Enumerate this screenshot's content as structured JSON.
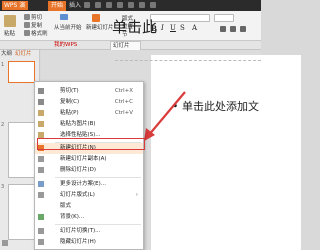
{
  "titlebar": {
    "app_label": "WPS 演示",
    "tab_start": "开始",
    "tab_insert": "插入"
  },
  "ribbon": {
    "paste": "粘贴",
    "cut": "剪切",
    "copy": "复制",
    "format_painter": "格式刷",
    "from_current": "从当前开始",
    "new_slide": "新建幻灯片",
    "layout": "版式",
    "reset": "重置",
    "section": "节"
  },
  "doctabs": {
    "wps": "我的WPS",
    "active": "幻灯片"
  },
  "left_panel": {
    "outline": "大纲",
    "slides": "幻灯片",
    "slide_numbers": [
      "1",
      "2",
      "3"
    ]
  },
  "slide": {
    "title": "单击此",
    "bullet": "• 单击此处添加文"
  },
  "context_menu": {
    "items": [
      {
        "label": "剪切(T)",
        "shortcut": "Ctrl+X"
      },
      {
        "label": "复制(C)",
        "shortcut": "Ctrl+C"
      },
      {
        "label": "粘贴(P)",
        "shortcut": "Ctrl+V"
      },
      {
        "label": "粘贴为图片(B)",
        "shortcut": ""
      },
      {
        "label": "选择性粘贴(S)...",
        "shortcut": ""
      },
      {
        "label": "新建幻灯片(N)",
        "shortcut": ""
      },
      {
        "label": "新建幻灯片副本(A)",
        "shortcut": ""
      },
      {
        "label": "删除幻灯片(D)",
        "shortcut": ""
      },
      {
        "label": "更多设计方案(E)...",
        "shortcut": ""
      },
      {
        "label": "幻灯片版式(L)",
        "shortcut": ""
      },
      {
        "label": "版式",
        "shortcut": ""
      },
      {
        "label": "背景(K)...",
        "shortcut": ""
      },
      {
        "label": "幻灯片切换(T)...",
        "shortcut": ""
      },
      {
        "label": "隐藏幻灯片(H)",
        "shortcut": ""
      }
    ]
  },
  "colors": {
    "accent": "#e8742a",
    "highlight_box": "#d93a3a"
  }
}
